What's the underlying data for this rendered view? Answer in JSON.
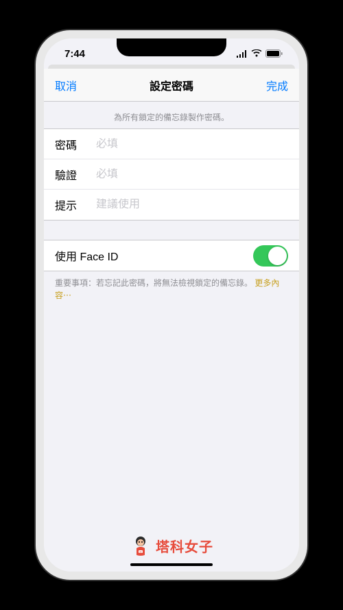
{
  "statusBar": {
    "time": "7:44"
  },
  "navBar": {
    "cancel": "取消",
    "title": "設定密碼",
    "done": "完成"
  },
  "sectionHeader": "為所有鎖定的備忘錄製作密碼。",
  "form": {
    "password": {
      "label": "密碼",
      "placeholder": "必填"
    },
    "verify": {
      "label": "驗證",
      "placeholder": "必填"
    },
    "hint": {
      "label": "提示",
      "placeholder": "建議使用"
    }
  },
  "faceId": {
    "label": "使用 Face ID",
    "enabled": true
  },
  "footerNote": {
    "prefix": "重要事項：若忘記此密碼，將無法檢視鎖定的備忘錄。 ",
    "link": "更多內容⋯"
  },
  "watermark": {
    "text": "塔科女子"
  }
}
